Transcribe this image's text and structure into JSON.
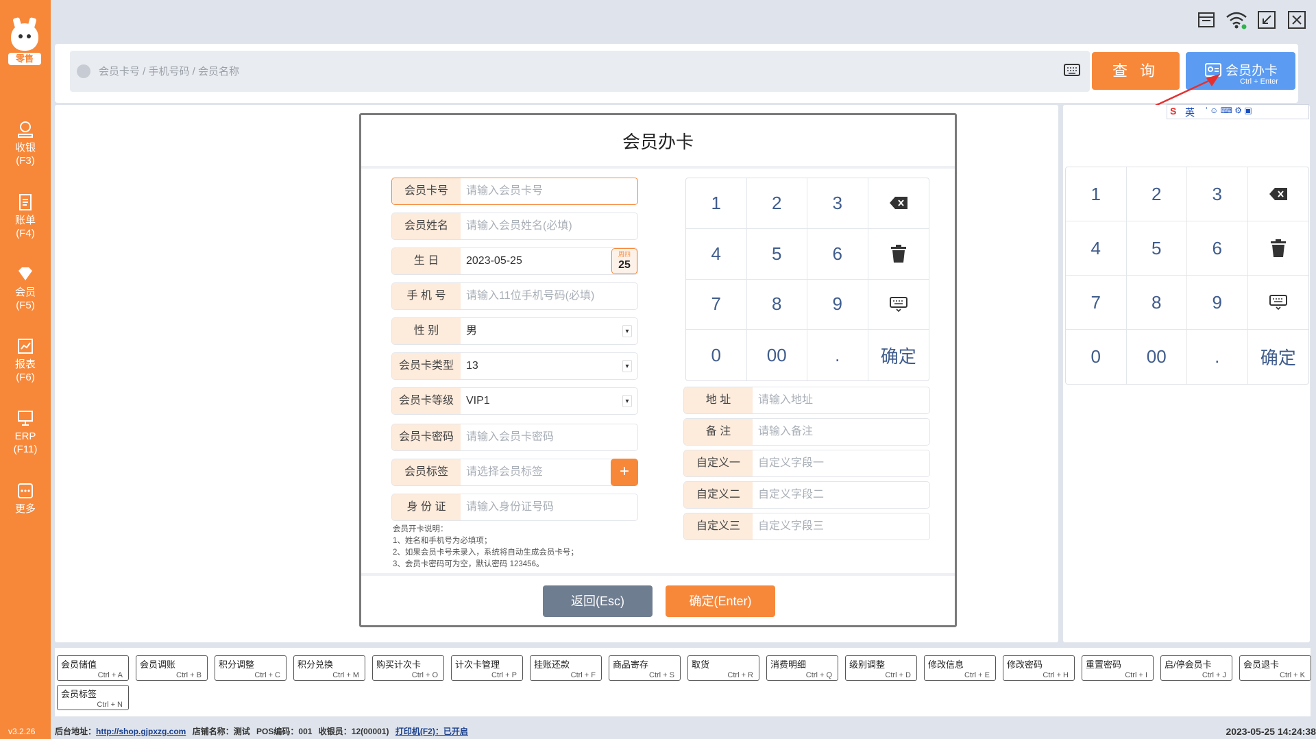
{
  "app": {
    "logo_tag": "零售",
    "version": "v3.2.26"
  },
  "sidebar": {
    "items": [
      {
        "label": "收银",
        "key": "(F3)",
        "icon": "cashier-icon"
      },
      {
        "label": "账单",
        "key": "(F4)",
        "icon": "bill-icon"
      },
      {
        "label": "会员",
        "key": "(F5)",
        "icon": "member-icon"
      },
      {
        "label": "报表",
        "key": "(F6)",
        "icon": "report-icon"
      },
      {
        "label": "ERP",
        "key": "(F11)",
        "icon": "erp-icon"
      },
      {
        "label": "更多",
        "key": "",
        "icon": "more-icon"
      }
    ]
  },
  "search": {
    "placeholder": "会员卡号 / 手机号码 / 会员名称",
    "query_label": "查 询",
    "card_label": "会员办卡",
    "card_hotkey": "Ctrl + Enter"
  },
  "numpad": {
    "keys": [
      "1",
      "2",
      "3",
      "⌫",
      "4",
      "5",
      "6",
      "🗑",
      "7",
      "8",
      "9",
      "⌨",
      "0",
      "00",
      ".",
      "确定"
    ]
  },
  "modal": {
    "title": "会员办卡",
    "fields": {
      "card_no": {
        "label": "会员卡号",
        "placeholder": "请输入会员卡号"
      },
      "name": {
        "label": "会员姓名",
        "placeholder": "请输入会员姓名(必填)"
      },
      "birthday": {
        "label": "生 日",
        "value": "2023-05-25",
        "weekday": "周四",
        "day": "25"
      },
      "phone": {
        "label": "手 机 号",
        "placeholder": "请输入11位手机号码(必填)"
      },
      "gender": {
        "label": "性 别",
        "value": "男"
      },
      "card_type": {
        "label": "会员卡类型",
        "value": "13"
      },
      "card_level": {
        "label": "会员卡等级",
        "value": "VIP1"
      },
      "password": {
        "label": "会员卡密码",
        "placeholder": "请输入会员卡密码"
      },
      "tags": {
        "label": "会员标签",
        "placeholder": "请选择会员标签"
      },
      "idcard": {
        "label": "身 份 证",
        "placeholder": "请输入身份证号码"
      },
      "address": {
        "label": "地 址",
        "placeholder": "请输入地址"
      },
      "remark": {
        "label": "备 注",
        "placeholder": "请输入备注"
      },
      "custom1": {
        "label": "自定义一",
        "placeholder": "自定义字段一"
      },
      "custom2": {
        "label": "自定义二",
        "placeholder": "自定义字段二"
      },
      "custom3": {
        "label": "自定义三",
        "placeholder": "自定义字段三"
      }
    },
    "notes": [
      "会员开卡说明：",
      "1、姓名和手机号为必填项；",
      "2、如果会员卡号未录入，系统将自动生成会员卡号；",
      "3、会员卡密码可为空，默认密码 123456。"
    ],
    "back_label": "返回(Esc)",
    "confirm_label": "确定(Enter)"
  },
  "shortcuts": [
    {
      "t": "会员储值",
      "h": "Ctrl + A"
    },
    {
      "t": "会员调账",
      "h": "Ctrl + B"
    },
    {
      "t": "积分调整",
      "h": "Ctrl + C"
    },
    {
      "t": "积分兑换",
      "h": "Ctrl + M"
    },
    {
      "t": "购买计次卡",
      "h": "Ctrl + O"
    },
    {
      "t": "计次卡管理",
      "h": "Ctrl + P"
    },
    {
      "t": "挂账还款",
      "h": "Ctrl + F"
    },
    {
      "t": "商品寄存",
      "h": "Ctrl + S"
    },
    {
      "t": "取货",
      "h": "Ctrl + R"
    },
    {
      "t": "消费明细",
      "h": "Ctrl + Q"
    },
    {
      "t": "级别调整",
      "h": "Ctrl + D"
    },
    {
      "t": "修改信息",
      "h": "Ctrl + E"
    },
    {
      "t": "修改密码",
      "h": "Ctrl + H"
    },
    {
      "t": "重置密码",
      "h": "Ctrl + I"
    },
    {
      "t": "启/停会员卡",
      "h": "Ctrl + J"
    },
    {
      "t": "会员退卡",
      "h": "Ctrl + K"
    },
    {
      "t": "会员标签",
      "h": "Ctrl + N"
    }
  ],
  "status": {
    "backend_label": "后台地址：",
    "backend_url": "http://shop.gjpxzg.com",
    "store": "店铺名称：测试",
    "pos": "POS编码：001",
    "cashier": "收银员：12(00001)",
    "printer": "打印机(F2)：已开启",
    "datetime": "2023-05-25 14:24:38"
  },
  "ime": {
    "mode": "英"
  },
  "colors": {
    "accent": "#f7883a",
    "primary": "#5b9cf2"
  }
}
